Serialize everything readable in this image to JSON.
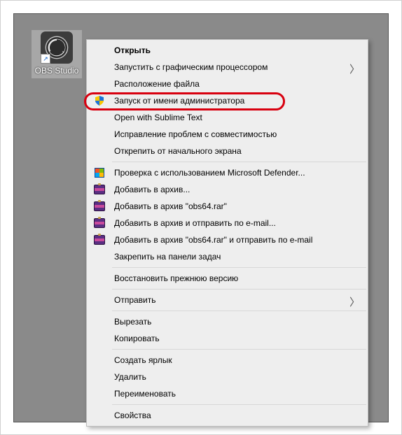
{
  "desktop_icon": {
    "label": "OBS Studio"
  },
  "ctx": {
    "open": "Открыть",
    "gpu": "Запустить с графическим процессором",
    "file_loc": "Расположение файла",
    "run_admin": "Запуск от имени администратора",
    "sublime": "Open with Sublime Text",
    "compat": "Исправление проблем с совместимостью",
    "unpin_start": "Открепить от начального экрана",
    "defender": "Проверка с использованием Microsoft Defender...",
    "add_archive": "Добавить в архив...",
    "add_obs64": "Добавить в архив \"obs64.rar\"",
    "add_email": "Добавить в архив и отправить по e-mail...",
    "add_obs64_email": "Добавить в архив \"obs64.rar\" и отправить по e-mail",
    "pin_taskbar": "Закрепить на панели задач",
    "restore_prev": "Восстановить прежнюю версию",
    "send_to": "Отправить",
    "cut": "Вырезать",
    "copy": "Копировать",
    "create_shortcut": "Создать ярлык",
    "delete": "Удалить",
    "rename": "Переименовать",
    "properties": "Свойства"
  },
  "highlight_item": "run_admin"
}
